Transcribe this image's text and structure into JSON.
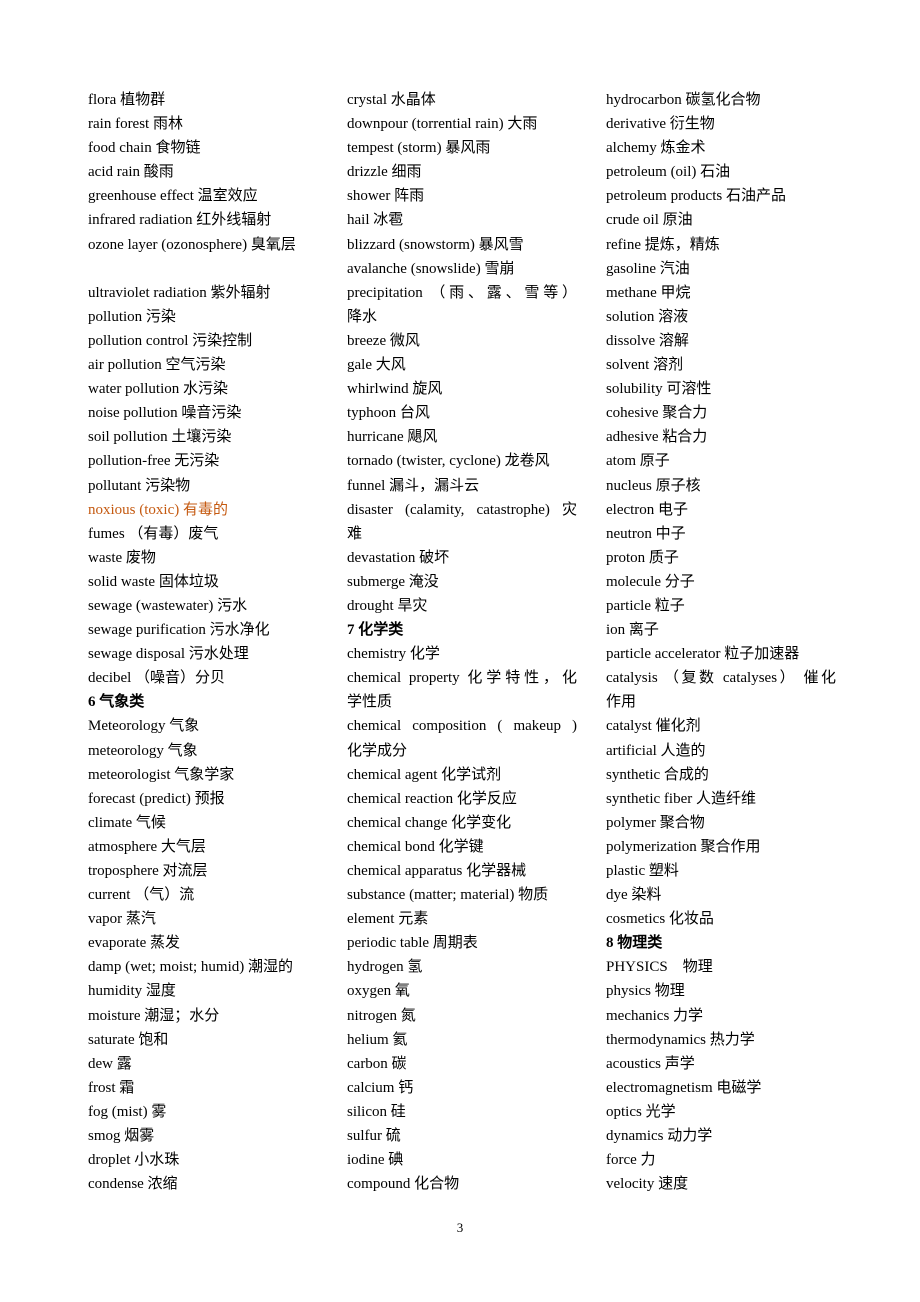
{
  "columns": [
    {
      "entries": [
        {
          "text": "flora 植物群"
        },
        {
          "text": "rain forest 雨林"
        },
        {
          "text": "food chain 食物链"
        },
        {
          "text": "acid rain 酸雨"
        },
        {
          "text": "greenhouse effect 温室效应"
        },
        {
          "text": "infrared radiation 红外线辐射"
        },
        {
          "text": "ozone layer (ozonosphere) 臭氧层"
        },
        {
          "text": "",
          "type": "blank"
        },
        {
          "text": "ultraviolet radiation 紫外辐射"
        },
        {
          "text": "pollution 污染"
        },
        {
          "text": "pollution control 污染控制"
        },
        {
          "text": "air pollution 空气污染"
        },
        {
          "text": "water pollution 水污染"
        },
        {
          "text": "noise pollution 噪音污染"
        },
        {
          "text": "soil pollution 土壤污染"
        },
        {
          "text": "pollution-free 无污染"
        },
        {
          "text": "pollutant 污染物"
        },
        {
          "text": "noxious (toxic) 有毒的",
          "type": "highlight"
        },
        {
          "text": "fumes （有毒）废气"
        },
        {
          "text": "waste 废物"
        },
        {
          "text": "solid waste 固体垃圾"
        },
        {
          "text": "sewage (wastewater) 污水"
        },
        {
          "text": "sewage purification 污水净化"
        },
        {
          "text": "sewage disposal 污水处理"
        },
        {
          "text": "decibel （噪音）分贝"
        },
        {
          "text": "6 气象类",
          "type": "heading"
        },
        {
          "text": "Meteorology 气象"
        },
        {
          "text": "meteorology 气象"
        },
        {
          "text": "meteorologist 气象学家"
        },
        {
          "text": "forecast (predict) 预报"
        },
        {
          "text": "climate 气候"
        },
        {
          "text": "atmosphere 大气层"
        },
        {
          "text": "troposphere 对流层"
        },
        {
          "text": "current （气）流"
        },
        {
          "text": "vapor 蒸汽"
        },
        {
          "text": "evaporate 蒸发"
        },
        {
          "text": "damp (wet; moist; humid) 潮湿的"
        },
        {
          "text": "humidity 湿度"
        },
        {
          "text": "moisture 潮湿；水分"
        },
        {
          "text": "saturate 饱和"
        },
        {
          "text": "dew 露"
        },
        {
          "text": "frost 霜"
        },
        {
          "text": "fog (mist) 雾"
        },
        {
          "text": "smog 烟雾"
        },
        {
          "text": "droplet 小水珠"
        },
        {
          "text": "condense 浓缩"
        }
      ]
    },
    {
      "entries": [
        {
          "text": "crystal 水晶体"
        },
        {
          "text": "downpour (torrential rain) 大雨"
        },
        {
          "text": "tempest (storm) 暴风雨"
        },
        {
          "text": "drizzle 细雨"
        },
        {
          "text": "shower 阵雨"
        },
        {
          "text": "hail 冰雹"
        },
        {
          "text": "blizzard (snowstorm) 暴风雪"
        },
        {
          "text": "avalanche (snowslide) 雪崩"
        },
        {
          "text": "precipitation （雨、露、雪等）",
          "type": "justify"
        },
        {
          "text": "降水"
        },
        {
          "text": "breeze 微风"
        },
        {
          "text": "gale 大风"
        },
        {
          "text": "whirlwind 旋风"
        },
        {
          "text": "typhoon 台风"
        },
        {
          "text": "hurricane 飓风"
        },
        {
          "text": "tornado (twister, cyclone) 龙卷风"
        },
        {
          "text": "funnel 漏斗，漏斗云"
        },
        {
          "text": "disaster (calamity, catastrophe) 灾",
          "type": "justify"
        },
        {
          "text": "难"
        },
        {
          "text": "devastation 破坏"
        },
        {
          "text": "submerge 淹没"
        },
        {
          "text": "drought 旱灾"
        },
        {
          "text": "7 化学类",
          "type": "heading"
        },
        {
          "text": "chemistry 化学"
        },
        {
          "text": "chemical property 化学特性，化",
          "type": "justify"
        },
        {
          "text": "学性质"
        },
        {
          "text": "chemical composition ( makeup )",
          "type": "justify"
        },
        {
          "text": "化学成分"
        },
        {
          "text": "chemical agent 化学试剂"
        },
        {
          "text": "chemical reaction 化学反应"
        },
        {
          "text": "chemical change 化学变化"
        },
        {
          "text": "chemical bond 化学键"
        },
        {
          "text": "chemical apparatus 化学器械"
        },
        {
          "text": "substance (matter; material) 物质"
        },
        {
          "text": "element 元素"
        },
        {
          "text": "periodic table 周期表"
        },
        {
          "text": "hydrogen 氢"
        },
        {
          "text": "oxygen 氧"
        },
        {
          "text": "nitrogen 氮"
        },
        {
          "text": "helium 氦"
        },
        {
          "text": "carbon 碳"
        },
        {
          "text": "calcium 钙"
        },
        {
          "text": "silicon 硅"
        },
        {
          "text": "sulfur 硫"
        },
        {
          "text": "iodine 碘"
        },
        {
          "text": "compound 化合物"
        }
      ]
    },
    {
      "entries": [
        {
          "text": "hydrocarbon 碳氢化合物"
        },
        {
          "text": "derivative 衍生物"
        },
        {
          "text": "alchemy 炼金术"
        },
        {
          "text": "petroleum (oil) 石油"
        },
        {
          "text": "petroleum products 石油产品"
        },
        {
          "text": "crude oil 原油"
        },
        {
          "text": "refine 提炼，精炼"
        },
        {
          "text": "gasoline 汽油"
        },
        {
          "text": "methane 甲烷"
        },
        {
          "text": "solution 溶液"
        },
        {
          "text": "dissolve 溶解"
        },
        {
          "text": "solvent 溶剂"
        },
        {
          "text": "solubility 可溶性"
        },
        {
          "text": "cohesive 聚合力"
        },
        {
          "text": "adhesive 粘合力"
        },
        {
          "text": "atom 原子"
        },
        {
          "text": "nucleus 原子核"
        },
        {
          "text": "electron 电子"
        },
        {
          "text": "neutron 中子"
        },
        {
          "text": "proton 质子"
        },
        {
          "text": "molecule 分子"
        },
        {
          "text": "particle 粒子"
        },
        {
          "text": "ion 离子"
        },
        {
          "text": "particle accelerator 粒子加速器"
        },
        {
          "text": "catalysis （复数 catalyses） 催化",
          "type": "justify"
        },
        {
          "text": "作用"
        },
        {
          "text": "catalyst 催化剂"
        },
        {
          "text": "artificial 人造的"
        },
        {
          "text": "synthetic 合成的"
        },
        {
          "text": "synthetic fiber 人造纤维"
        },
        {
          "text": "polymer 聚合物"
        },
        {
          "text": "polymerization 聚合作用"
        },
        {
          "text": "plastic 塑料"
        },
        {
          "text": "dye 染料"
        },
        {
          "text": "cosmetics 化妆品"
        },
        {
          "text": "8 物理类",
          "type": "heading"
        },
        {
          "text": " PHYSICS　物理"
        },
        {
          "text": "physics 物理"
        },
        {
          "text": "mechanics 力学"
        },
        {
          "text": "thermodynamics 热力学"
        },
        {
          "text": "acoustics 声学"
        },
        {
          "text": "electromagnetism 电磁学"
        },
        {
          "text": "optics 光学"
        },
        {
          "text": "dynamics 动力学"
        },
        {
          "text": "force 力"
        },
        {
          "text": "velocity 速度"
        }
      ]
    }
  ],
  "page_number": "3",
  "colors": {
    "text": "#000000",
    "highlight": "#c55a11",
    "background": "#ffffff"
  }
}
